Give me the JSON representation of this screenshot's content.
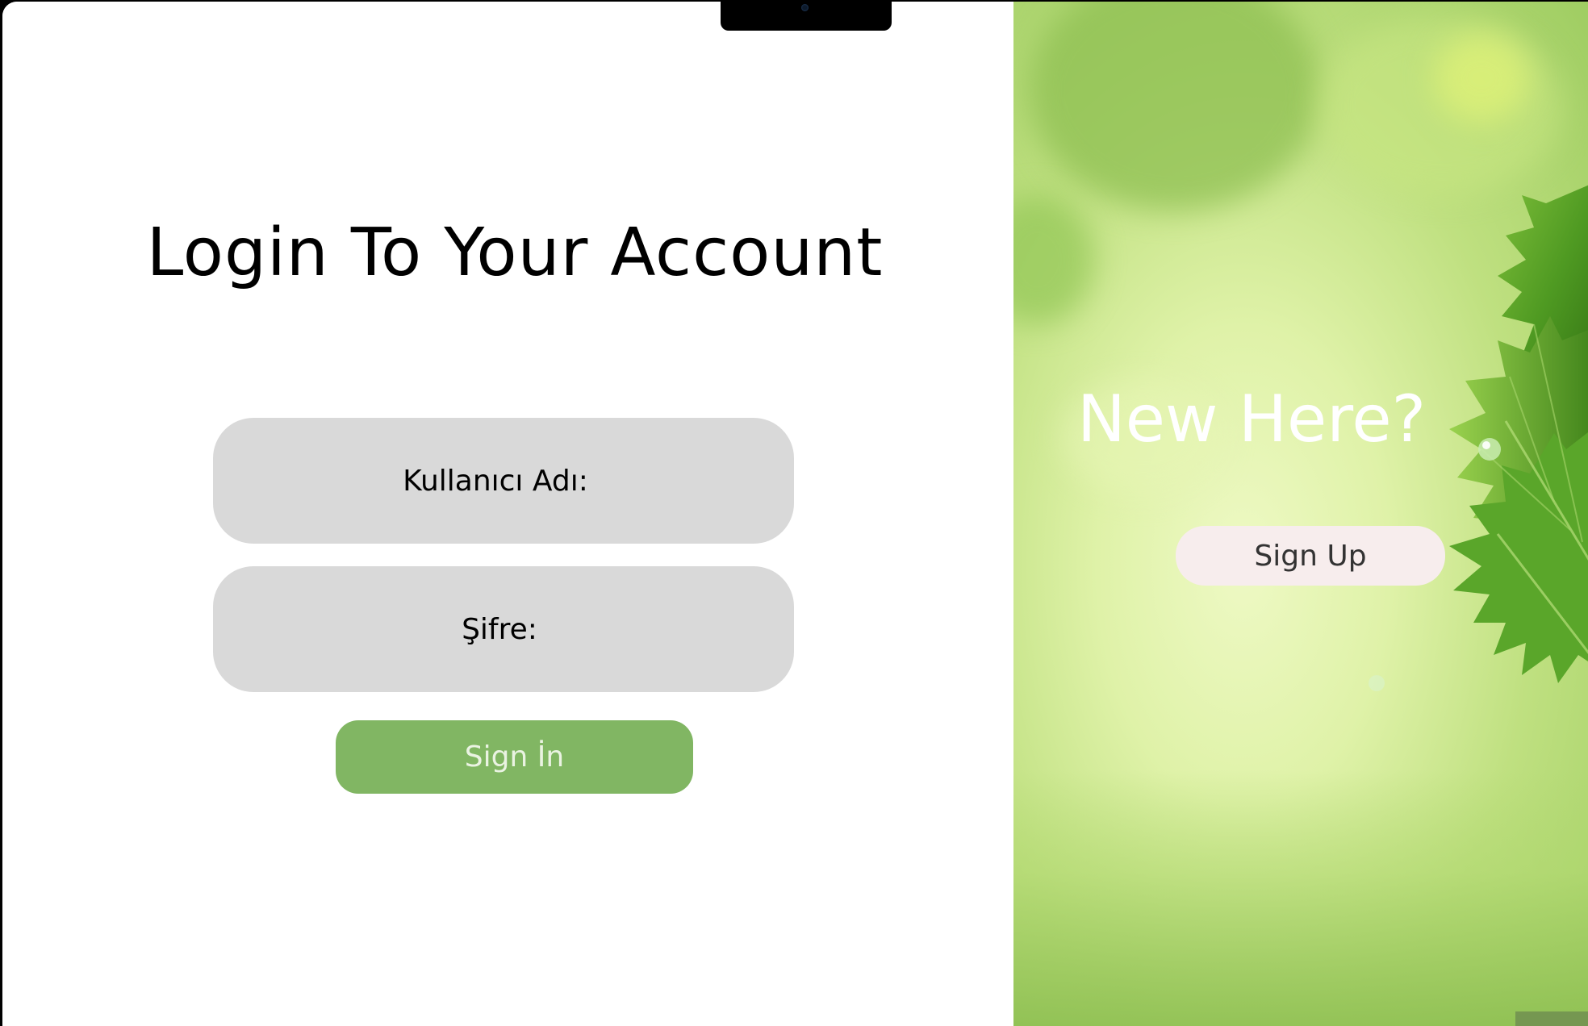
{
  "login": {
    "title": "Login To Your Account",
    "username_label": "Kullanıcı Adı:",
    "password_label": "Şifre:",
    "signin_label": "Sign İn"
  },
  "signup": {
    "heading": "New Here?",
    "signup_label": "Sign Up"
  },
  "colors": {
    "signin_button": "#81b663",
    "field_background": "#d9d9d9",
    "signup_button": "#f7eded",
    "panel_green": "#bfe080"
  },
  "icons": {
    "background_image": "green-leaf-bokeh-image"
  }
}
